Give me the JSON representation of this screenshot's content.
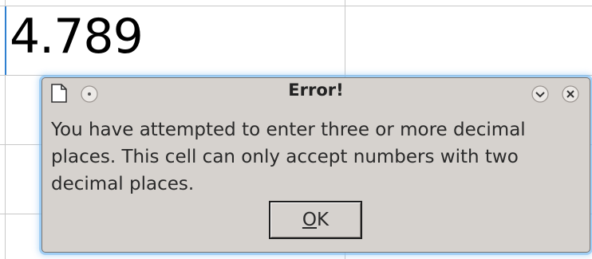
{
  "spreadsheet": {
    "cell_value": "4.789"
  },
  "dialog": {
    "title": "Error!",
    "message": "You have attempted to enter three or more decimal places. This cell can only accept numbers with two decimal places.",
    "ok_button": {
      "mnemonic": "O",
      "rest": "K"
    },
    "icons": {
      "app": "document-icon",
      "menu": "window-menu-icon",
      "minimize": "chevron-down-icon",
      "close": "close-icon"
    },
    "colors": {
      "dialog_bg": "#d6d2ce",
      "focus_glow": "#78b9f0",
      "selection_border": "#2f80d0"
    }
  }
}
